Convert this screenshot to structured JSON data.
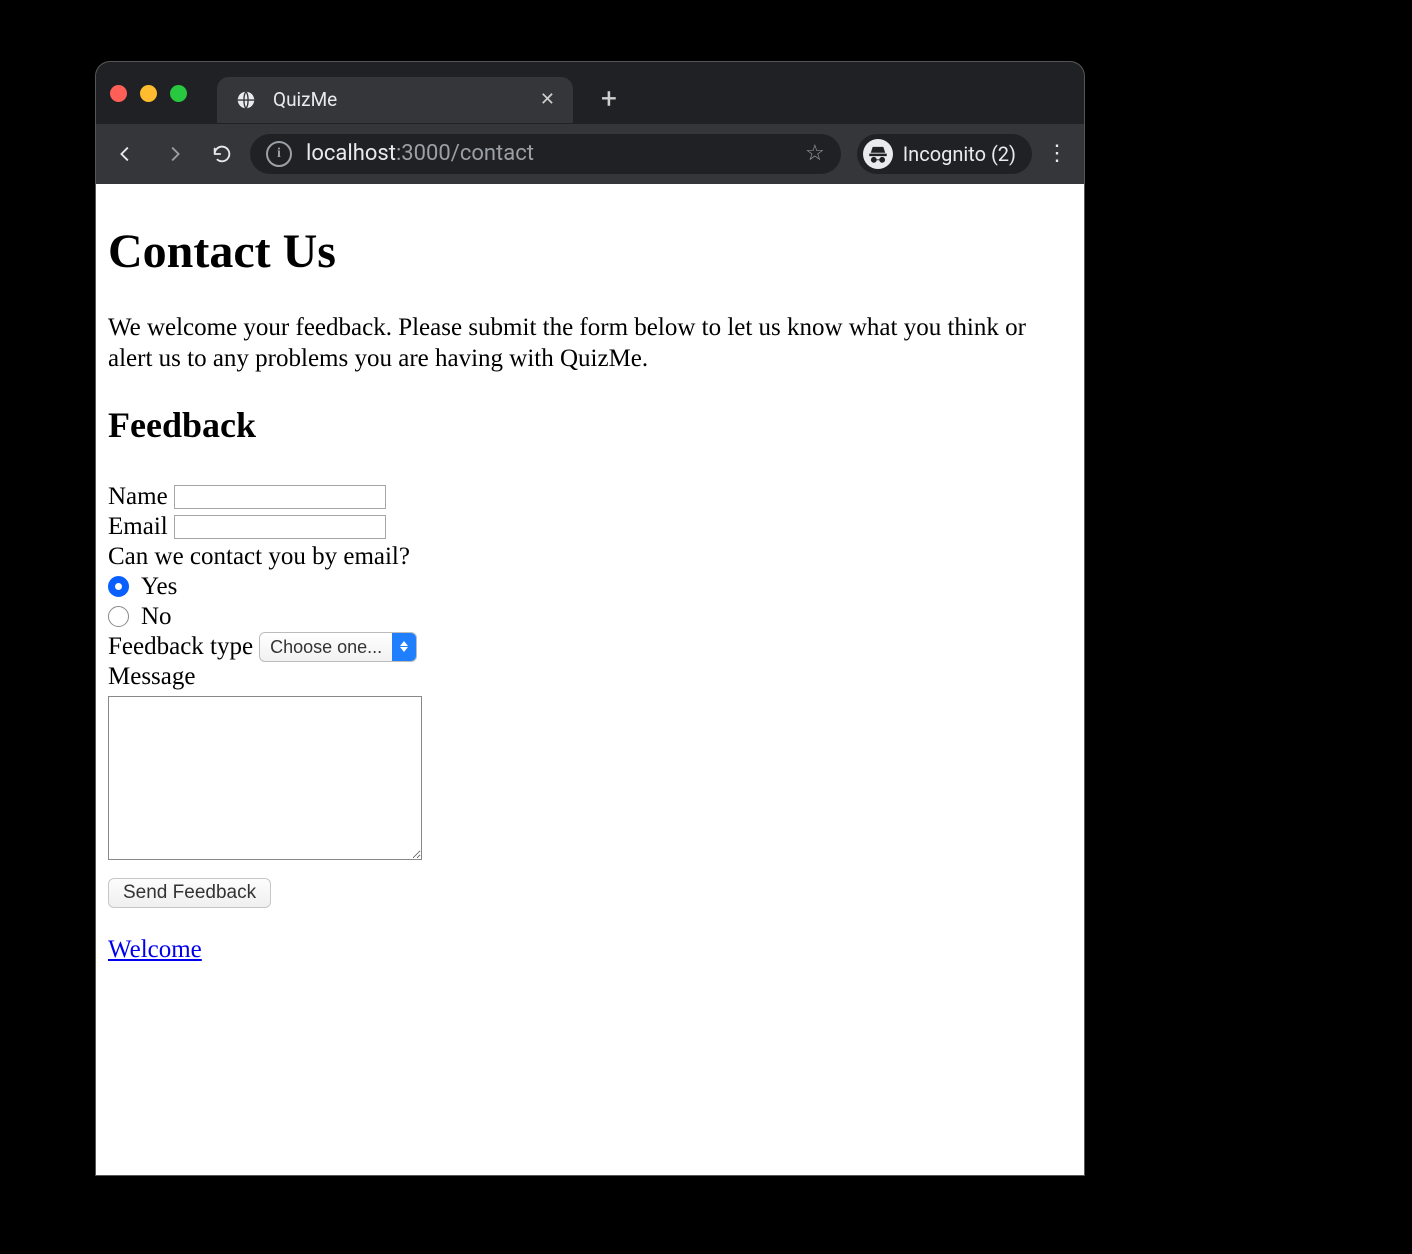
{
  "browser": {
    "tab_title": "QuizMe",
    "url_host": "localhost",
    "url_port_path": ":3000/contact",
    "incognito_label": "Incognito (2)"
  },
  "page": {
    "heading": "Contact Us",
    "intro": "We welcome your feedback. Please submit the form below to let us know what you think or alert us to any problems you are having with QuizMe.",
    "subheading": "Feedback",
    "labels": {
      "name": "Name",
      "email": "Email",
      "contact_q": "Can we contact you by email?",
      "yes": "Yes",
      "no": "No",
      "feedback_type": "Feedback type",
      "message": "Message"
    },
    "select_placeholder": "Choose one...",
    "submit_label": "Send Feedback",
    "footer_link": "Welcome",
    "values": {
      "name": "",
      "email": "",
      "contact_by_email": "yes",
      "feedback_type": "",
      "message": ""
    }
  }
}
